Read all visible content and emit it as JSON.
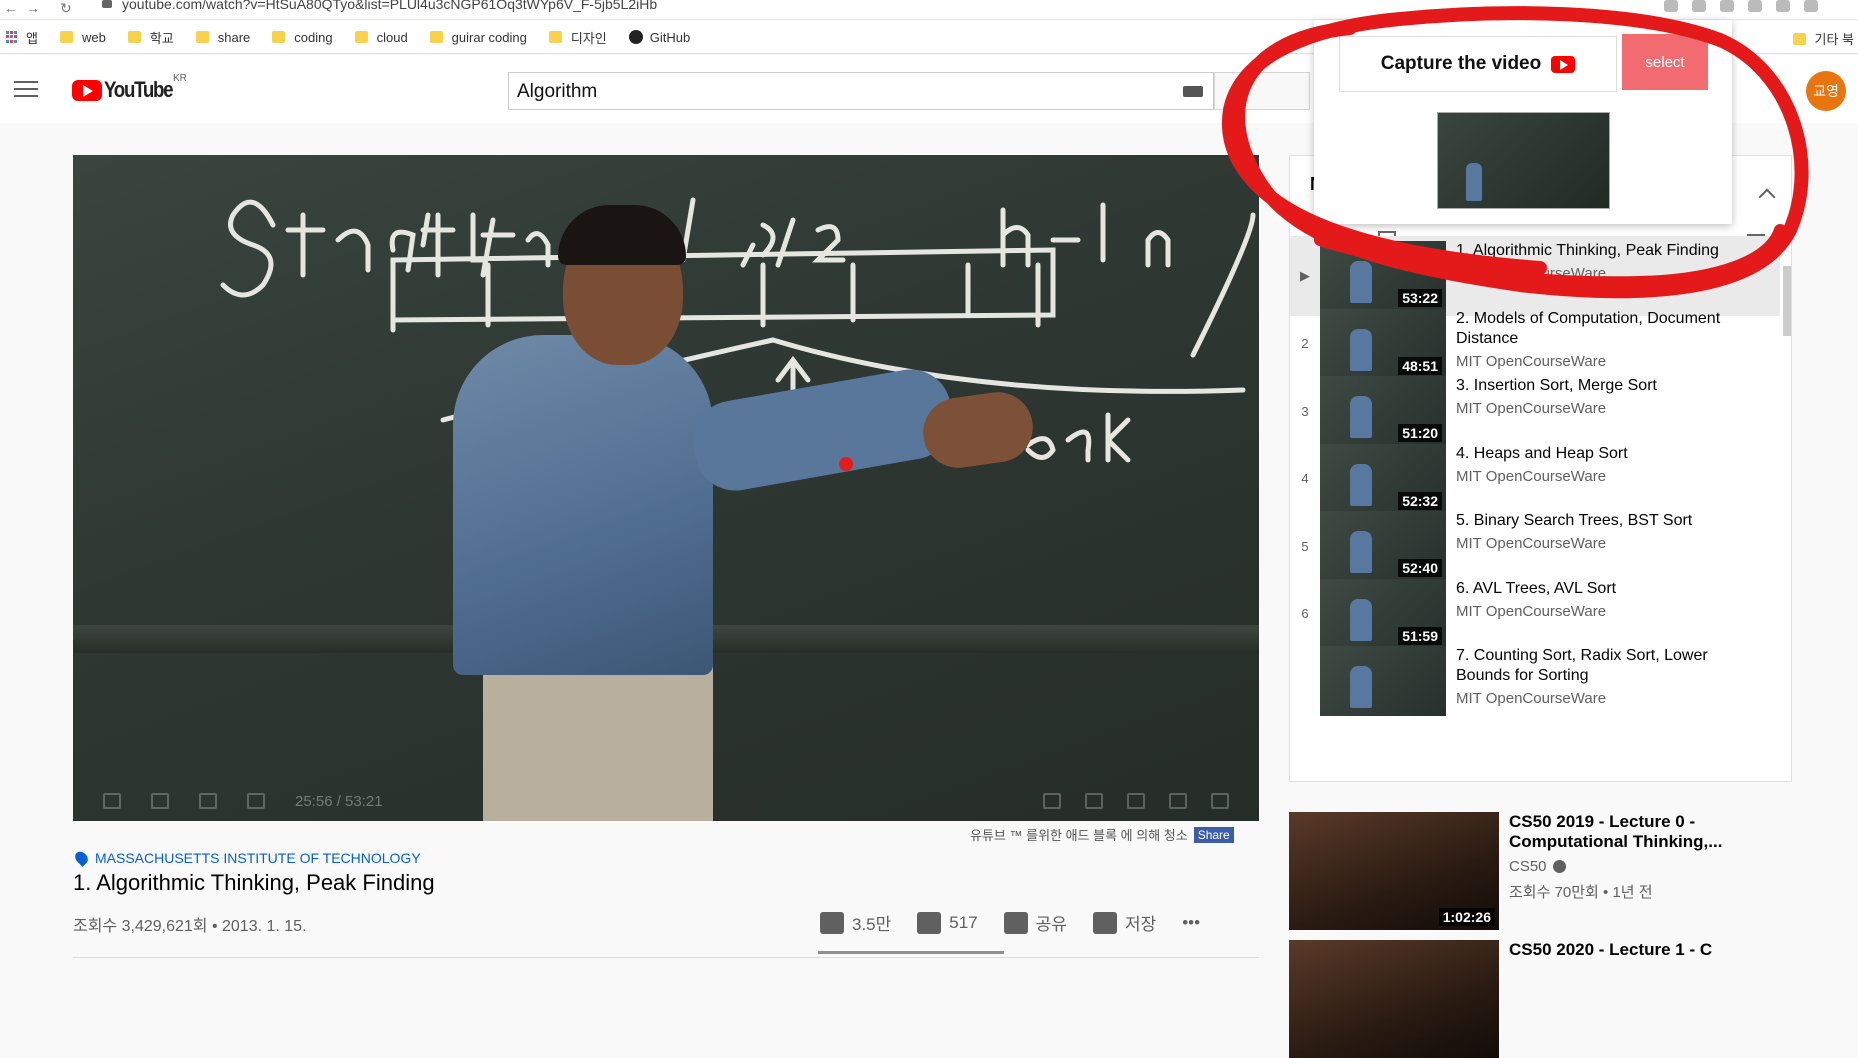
{
  "browser": {
    "url": "youtube.com/watch?v=HtSuA80QTyo&list=PLUl4u3cNGP61Oq3tWYp6V_F-5jb5L2iHb",
    "bookmarks": [
      {
        "label": "앱",
        "icon": "apps-grid-icon"
      },
      {
        "label": "web",
        "icon": "folder-icon"
      },
      {
        "label": "학교",
        "icon": "folder-icon"
      },
      {
        "label": "share",
        "icon": "folder-icon"
      },
      {
        "label": "coding",
        "icon": "folder-icon"
      },
      {
        "label": "cloud",
        "icon": "folder-icon"
      },
      {
        "label": "guirar coding",
        "icon": "folder-icon"
      },
      {
        "label": "디자인",
        "icon": "folder-icon"
      },
      {
        "label": "GitHub",
        "icon": "github-icon"
      }
    ],
    "other_bookmarks": "기타 북"
  },
  "header": {
    "logo_text": "YouTube",
    "logo_region": "KR",
    "search_value": "Algorithm",
    "avatar_text": "교영"
  },
  "player": {
    "time": "25:56 / 53:21"
  },
  "below_video": {
    "share_caption": "유튜브 ™ 를위한 애드 블록 에 의해 청소",
    "share_label": "Share",
    "location": "MASSACHUSETTS INSTITUTE OF TECHNOLOGY",
    "title": "1. Algorithmic Thinking, Peak Finding",
    "views": "조회수 3,429,621회 • 2013. 1. 15.",
    "likes": "3.5만",
    "dislikes": "517",
    "share": "공유",
    "save": "저장",
    "more": "•••"
  },
  "playlist": {
    "header_initial": "N",
    "items": [
      {
        "index": "▶",
        "title": "1. Algorithmic Thinking, Peak Finding",
        "channel": "MIT OpenCourseWare",
        "duration": "53:22",
        "active": true
      },
      {
        "index": "2",
        "title": "2. Models of Computation, Document Distance",
        "channel": "MIT OpenCourseWare",
        "duration": "48:51"
      },
      {
        "index": "3",
        "title": "3. Insertion Sort, Merge Sort",
        "channel": "MIT OpenCourseWare",
        "duration": "51:20"
      },
      {
        "index": "4",
        "title": "4. Heaps and Heap Sort",
        "channel": "MIT OpenCourseWare",
        "duration": "52:32"
      },
      {
        "index": "5",
        "title": "5. Binary Search Trees, BST Sort",
        "channel": "MIT OpenCourseWare",
        "duration": "52:40"
      },
      {
        "index": "6",
        "title": "6. AVL Trees, AVL Sort",
        "channel": "MIT OpenCourseWare",
        "duration": "51:59"
      },
      {
        "index": "",
        "title": "7. Counting Sort, Radix Sort, Lower Bounds for Sorting",
        "channel": "MIT OpenCourseWare",
        "duration": ""
      }
    ]
  },
  "recommended": [
    {
      "title": "CS50 2019 - Lecture 0 - Computational Thinking,...",
      "channel": "CS50",
      "meta": "조회수 70만회 • 1년 전",
      "duration": "1:02:26"
    },
    {
      "title": "CS50 2020 - Lecture 1 - C",
      "channel": "",
      "meta": "",
      "duration": ""
    }
  ],
  "extension": {
    "capture_label": "Capture the video",
    "select_label": "select"
  },
  "colors": {
    "youtube_red": "#ff0000",
    "select_button": "#f26b70",
    "annotation_red": "#e41a1a",
    "link_blue": "#065fd4"
  }
}
